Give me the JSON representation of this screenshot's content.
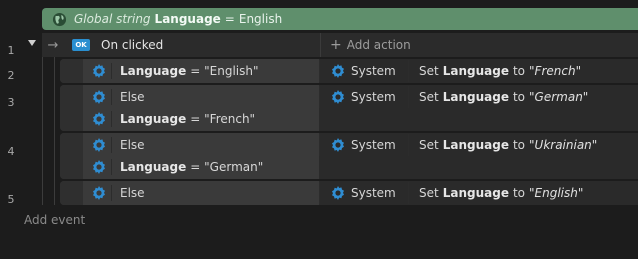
{
  "global_var": {
    "prefix": "Global string",
    "name": "Language",
    "equals": "=",
    "value": "English"
  },
  "event": {
    "number": "1",
    "trigger_badge": "OK",
    "trigger_label": "On clicked",
    "add_action_label": "Add action"
  },
  "sub_events": [
    {
      "number": "2",
      "conditions": [
        {
          "label": "",
          "var": "Language",
          "op": "=",
          "value": "\"English\""
        }
      ],
      "action": {
        "object": "System",
        "prefix": "Set",
        "var": "Language",
        "to": "to",
        "value": "\"French\""
      }
    },
    {
      "number": "3",
      "conditions": [
        {
          "label": "Else"
        },
        {
          "var": "Language",
          "op": "=",
          "value": "\"French\""
        }
      ],
      "action": {
        "object": "System",
        "prefix": "Set",
        "var": "Language",
        "to": "to",
        "value": "\"German\""
      }
    },
    {
      "number": "4",
      "conditions": [
        {
          "label": "Else"
        },
        {
          "var": "Language",
          "op": "=",
          "value": "\"German\""
        }
      ],
      "action": {
        "object": "System",
        "prefix": "Set",
        "var": "Language",
        "to": "to",
        "value": "\"Ukrainian\""
      }
    },
    {
      "number": "5",
      "conditions": [
        {
          "label": "Else"
        }
      ],
      "action": {
        "object": "System",
        "prefix": "Set",
        "var": "Language",
        "to": "to",
        "value": "\"English\""
      }
    }
  ],
  "add_event_label": "Add event",
  "colors": {
    "global_bar": "#5f8f6c",
    "background": "#1c1c1c",
    "row": "#3a3a3a",
    "gear": "#2f8dd2"
  }
}
